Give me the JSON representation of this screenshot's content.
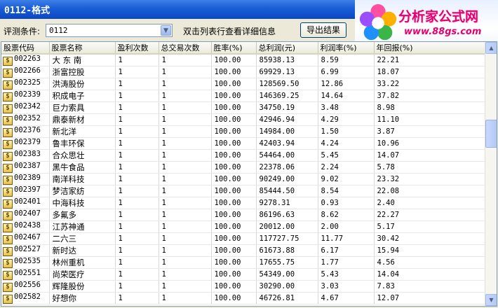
{
  "window": {
    "title": "0112-格式"
  },
  "logo": {
    "brand": "分析家公式网",
    "url": "www.88gs.com"
  },
  "toolbar": {
    "filter_label": "评测条件:",
    "filter_value": "0112",
    "hint": "双击列表行查看详细信息",
    "export_label": "导出结果"
  },
  "columns": [
    "股票代码",
    "股票名称",
    "盈利次数",
    "总交易次数",
    "胜率(%)",
    "总利润(元)",
    "利润率(%)",
    "年回报(%)"
  ],
  "rows": [
    [
      "002263",
      "大 东 南",
      "1",
      "1",
      "100.00",
      "85938.13",
      "8.59",
      "22.21"
    ],
    [
      "002266",
      "浙富控股",
      "1",
      "1",
      "100.00",
      "69929.13",
      "6.99",
      "18.07"
    ],
    [
      "002325",
      "洪涛股份",
      "1",
      "1",
      "100.00",
      "128569.50",
      "12.86",
      "33.22"
    ],
    [
      "002339",
      "积成电子",
      "1",
      "1",
      "100.00",
      "146369.25",
      "14.64",
      "37.82"
    ],
    [
      "002342",
      "巨力索具",
      "1",
      "1",
      "100.00",
      "34750.19",
      "3.48",
      "8.98"
    ],
    [
      "002352",
      "鼎泰新材",
      "1",
      "1",
      "100.00",
      "42946.94",
      "4.29",
      "11.10"
    ],
    [
      "002376",
      "新北洋",
      "1",
      "1",
      "100.00",
      "14984.00",
      "1.50",
      "3.87"
    ],
    [
      "002379",
      "鲁丰环保",
      "1",
      "1",
      "100.00",
      "42403.94",
      "4.24",
      "10.96"
    ],
    [
      "002383",
      "合众思壮",
      "1",
      "1",
      "100.00",
      "54464.00",
      "5.45",
      "14.07"
    ],
    [
      "002387",
      "黑牛食品",
      "1",
      "1",
      "100.00",
      "22378.06",
      "2.24",
      "5.78"
    ],
    [
      "002389",
      "南洋科技",
      "1",
      "1",
      "100.00",
      "90249.00",
      "9.02",
      "23.32"
    ],
    [
      "002397",
      "梦洁家纺",
      "1",
      "1",
      "100.00",
      "85444.50",
      "8.54",
      "22.08"
    ],
    [
      "002401",
      "中海科技",
      "1",
      "1",
      "100.00",
      "9278.31",
      "0.93",
      "2.40"
    ],
    [
      "002407",
      "多氟多",
      "1",
      "1",
      "100.00",
      "86196.63",
      "8.62",
      "22.27"
    ],
    [
      "002438",
      "江苏神通",
      "1",
      "1",
      "100.00",
      "20012.00",
      "2.00",
      "5.17"
    ],
    [
      "002467",
      "二六三",
      "1",
      "1",
      "100.00",
      "117727.75",
      "11.77",
      "30.42"
    ],
    [
      "002527",
      "新时达",
      "1",
      "1",
      "100.00",
      "61673.88",
      "6.17",
      "15.94"
    ],
    [
      "002535",
      "林州重机",
      "1",
      "1",
      "100.00",
      "17655.75",
      "1.77",
      "4.56"
    ],
    [
      "002551",
      "尚荣医疗",
      "1",
      "1",
      "100.00",
      "54349.00",
      "5.43",
      "14.04"
    ],
    [
      "002556",
      "辉隆股份",
      "1",
      "1",
      "100.00",
      "30290.00",
      "3.03",
      "7.83"
    ],
    [
      "002582",
      "好想你",
      "1",
      "1",
      "100.00",
      "46726.81",
      "4.67",
      "12.07"
    ]
  ],
  "icons": {
    "row": "stock-dollar-icon"
  },
  "colors": {
    "title_bar": "#1a5dd6",
    "brand": "#e4006e"
  }
}
